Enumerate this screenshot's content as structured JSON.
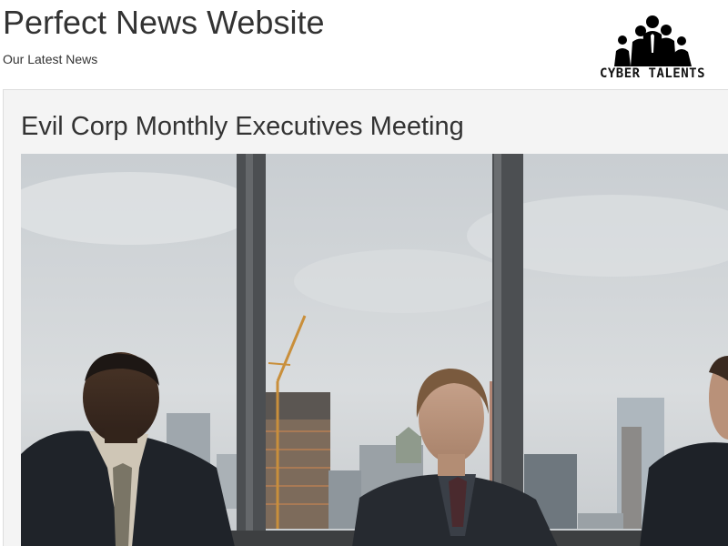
{
  "header": {
    "site_title": "Perfect News Website",
    "tagline": "Our Latest News",
    "logo_text": "CYBER TALENTS",
    "logo_icon": "business-people-silhouette-icon"
  },
  "article": {
    "title": "Evil Corp Monthly Executives Meeting",
    "image_subject": "three-executives-meeting-room-photo"
  },
  "colors": {
    "page_background": "#ffffff",
    "content_background": "#f4f4f4",
    "text": "#333333"
  }
}
